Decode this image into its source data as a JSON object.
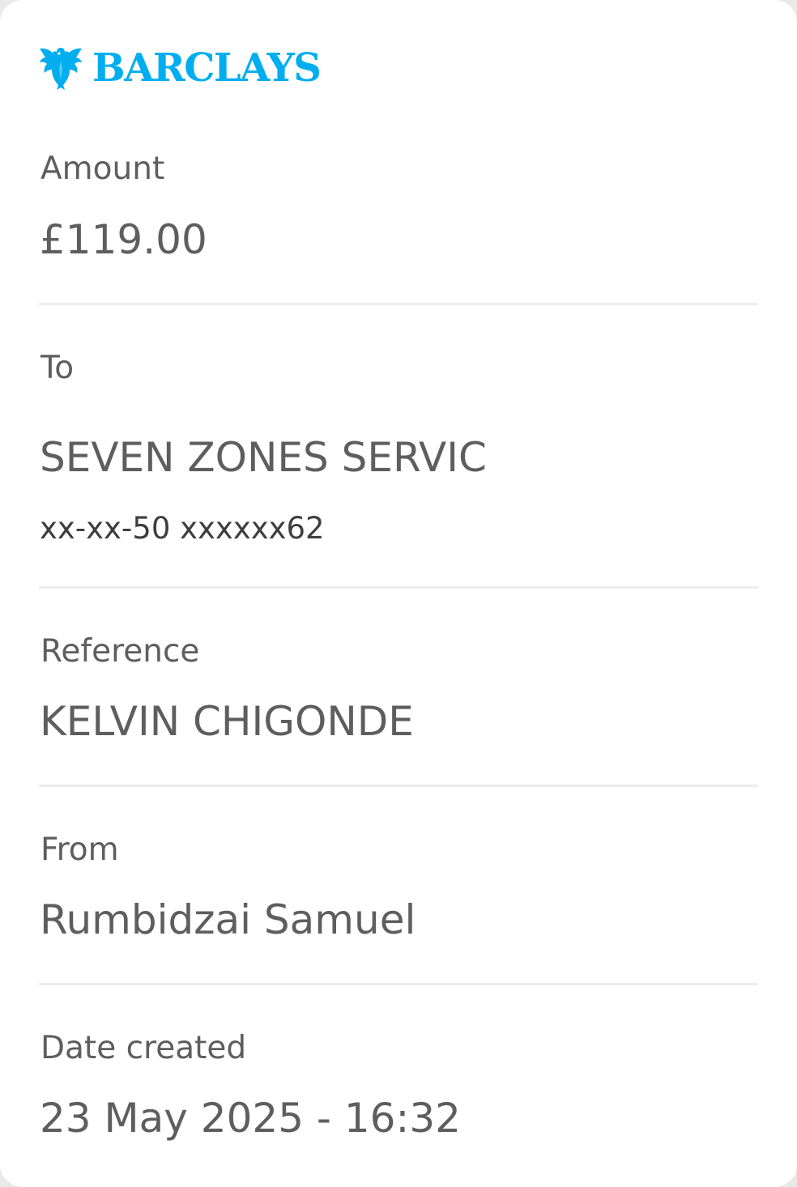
{
  "brand": {
    "name": "BARCLAYS",
    "icon": "eagle-icon",
    "color": "#00aeef"
  },
  "amount": {
    "label": "Amount",
    "value": "£119.00"
  },
  "to": {
    "label": "To",
    "name": "SEVEN ZONES SERVIC",
    "account": "xx-xx-50 xxxxxx62"
  },
  "reference": {
    "label": "Reference",
    "value": "KELVIN CHIGONDE"
  },
  "from": {
    "label": "From",
    "value": "Rumbidzai Samuel"
  },
  "date_created": {
    "label": "Date created",
    "value": "23 May 2025 - 16:32"
  },
  "colors": {
    "text": "#5e5e60",
    "divider": "#ececee",
    "background": "#ffffff"
  }
}
